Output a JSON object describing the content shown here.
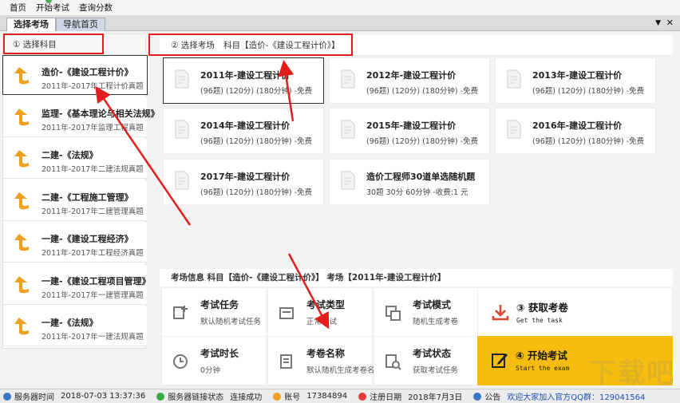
{
  "menu": [
    "首页",
    "开始考试",
    "查询分数"
  ],
  "tabs": {
    "active": "选择考场",
    "inactive": "导航首页",
    "dropdown_glyph": "▼",
    "close_glyph": "✕"
  },
  "left": {
    "header": "① 选择科目",
    "subjects": [
      {
        "title": "造价-《建设工程计价》",
        "sub": "2011年-2017年工程计价真题"
      },
      {
        "title": "监理-《基本理论与相关法规》",
        "sub": "2011年-2017年监理工程真题"
      },
      {
        "title": "二建-《法规》",
        "sub": "2011年-2017年二建法规真题"
      },
      {
        "title": "二建-《工程施工管理》",
        "sub": "2011年-2017年二建管理真题"
      },
      {
        "title": "一建-《建设工程经济》",
        "sub": "2011年-2017年工程经济真题"
      },
      {
        "title": "一建-《建设工程项目管理》",
        "sub": "2011年-2017年一建管理真题"
      },
      {
        "title": "一建-《法规》",
        "sub": "2011年-2017年一建法规真题"
      }
    ]
  },
  "rooms": {
    "header": "② 选择考场",
    "subject": "科目【造价-《建设工程计价》】",
    "cards": [
      {
        "title": "2011年-建设工程计价",
        "sub": "(96题) (120分) (180分钟) -免费"
      },
      {
        "title": "2012年-建设工程计价",
        "sub": "(96题) (120分) (180分钟) -免费"
      },
      {
        "title": "2013年-建设工程计价",
        "sub": "(96题) (120分) (180分钟) -免费"
      },
      {
        "title": "2014年-建设工程计价",
        "sub": "(96题) (120分) (180分钟) -免费"
      },
      {
        "title": "2015年-建设工程计价",
        "sub": "(96题) (120分) (180分钟) -免费"
      },
      {
        "title": "2016年-建设工程计价",
        "sub": "(96题) (120分) (180分钟) -免费"
      },
      {
        "title": "2017年-建设工程计价",
        "sub": "(96题) (120分) (180分钟) -免费"
      },
      {
        "title": "造价工程师30道单选随机题",
        "sub": "30题 30分 60分钟 -收费:1 元"
      }
    ]
  },
  "info": {
    "header": "考场信息  科目【造价-《建设工程计价》】 考场【2011年-建设工程计价】",
    "items": [
      {
        "title": "考试任务",
        "value": "默认随机考试任务"
      },
      {
        "title": "考试类型",
        "value": "正常考试"
      },
      {
        "title": "考试模式",
        "value": "随机生成考卷"
      },
      {
        "title": "考试时长",
        "value": "0分钟"
      },
      {
        "title": "考卷名称",
        "value": "默认随机生成考卷名"
      },
      {
        "title": "考试状态",
        "value": "获取考试任务"
      }
    ],
    "get_task": {
      "title": "③ 获取考卷",
      "sub": "Get the task"
    },
    "start": {
      "title": "④ 开始考试",
      "sub": "Start the exam"
    }
  },
  "status": {
    "server_time_label": "服务器时间",
    "server_time": "2018-07-03 13:37:36",
    "conn_label": "服务器链接状态",
    "conn": "连接成功",
    "account_label": "账号",
    "account": "17384894",
    "reg_label": "注册日期",
    "reg": "2018年7月3日",
    "notice_label": "公告",
    "notice": "欢迎大家加入官方QQ群：129041564"
  },
  "watermark": "下载吧",
  "colors": {
    "accent_yellow": "#f7bd0e",
    "annotation_red": "#e41d1d",
    "icon_orange": "#f0a020"
  }
}
